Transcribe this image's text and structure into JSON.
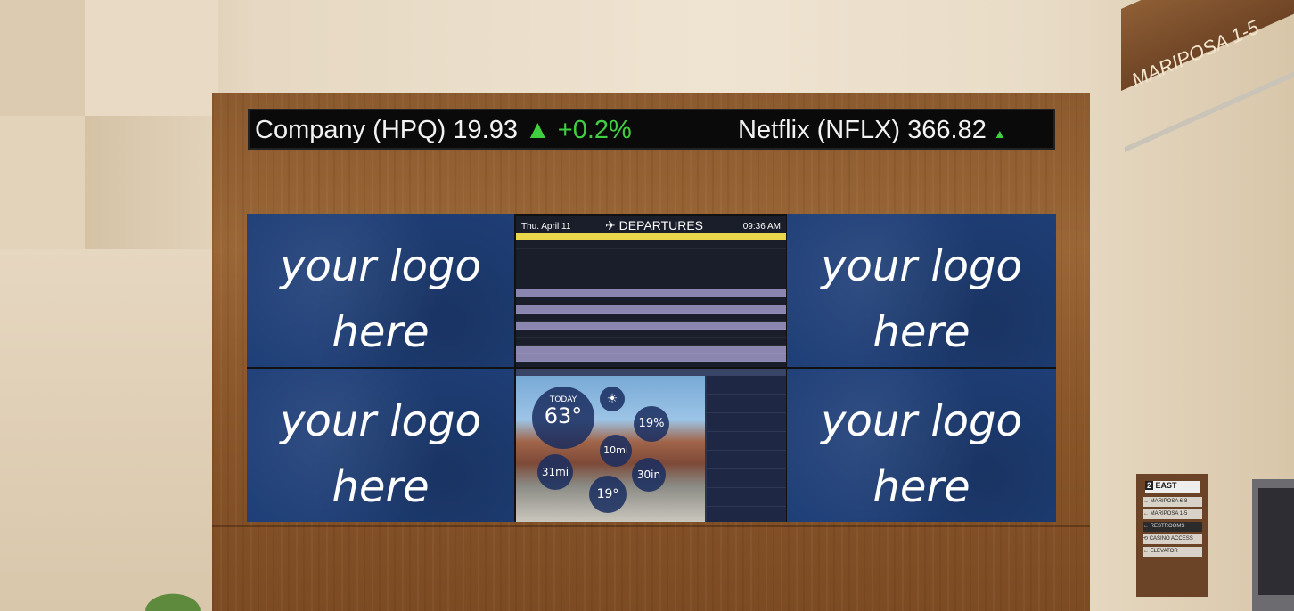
{
  "ticker": {
    "item1_text": "Company (HPQ) 19.93",
    "item1_arrow": "▲",
    "item1_change": "+0.2%",
    "item2_text": "Netflix (NFLX) 366.82",
    "item2_arrow": "▲"
  },
  "tiles": {
    "top_left": "your logo here",
    "top_right": "your logo here",
    "bottom_left": "your logo here",
    "bottom_right": "your logo here"
  },
  "departures": {
    "date": "Thu. April 11",
    "title": "DEPARTURES",
    "time": "09:36 AM",
    "icon": "plane-icon"
  },
  "weather": {
    "today_label": "TODAY",
    "today_temp": "63°",
    "humidity": "19%",
    "wind": "10mi",
    "low": "19°",
    "pressure": "30in",
    "visibility": "31mi"
  },
  "wall_sign": {
    "text": "MARIPOSA 1-5"
  },
  "directory": {
    "level": "2",
    "heading": "EAST",
    "items": [
      "→ MARIPOSA 6-8",
      "← MARIPOSA 1-5",
      "← RESTROOMS",
      "⟲ CASINO ACCESS",
      "← ELEVATOR"
    ]
  },
  "colors": {
    "tile_blue": "#1f3f78",
    "ticker_up": "#3fcf3f",
    "wood": "#8b5a2e"
  }
}
